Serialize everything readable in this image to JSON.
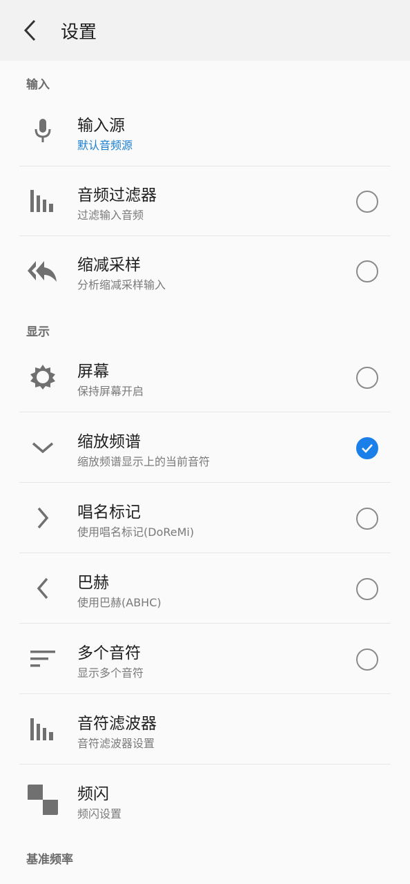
{
  "header": {
    "title": "设置",
    "back_icon": "back-arrow-icon"
  },
  "sections": {
    "input": {
      "header": "输入",
      "items": [
        {
          "title": "输入源",
          "subtitle": "默认音频源",
          "icon": "microphone-icon"
        },
        {
          "title": "音频过滤器",
          "subtitle": "过滤输入音频",
          "icon": "bars-icon",
          "checked": false
        },
        {
          "title": "缩减采样",
          "subtitle": "分析缩减采样输入",
          "icon": "double-reply-icon",
          "checked": false
        }
      ]
    },
    "display": {
      "header": "显示",
      "items": [
        {
          "title": "屏幕",
          "subtitle": "保持屏幕开启",
          "icon": "brightness-icon",
          "checked": false
        },
        {
          "title": "缩放频谱",
          "subtitle": "缩放频谱显示上的当前音符",
          "icon": "chevron-down-icon",
          "checked": true
        },
        {
          "title": "唱名标记",
          "subtitle": "使用唱名标记(DoReMi)",
          "icon": "chevron-right-icon",
          "checked": false
        },
        {
          "title": "巴赫",
          "subtitle": "使用巴赫(ABHC)",
          "icon": "chevron-left-icon",
          "checked": false
        },
        {
          "title": "多个音符",
          "subtitle": "显示多个音符",
          "icon": "sort-lines-icon",
          "checked": false
        },
        {
          "title": "音符滤波器",
          "subtitle": "音符滤波器设置",
          "icon": "bars-icon"
        },
        {
          "title": "频闪",
          "subtitle": "频闪设置",
          "icon": "checker-icon"
        }
      ]
    },
    "reference": {
      "header": "基准频率"
    }
  },
  "colors": {
    "accent": "#1a7fe8",
    "link": "#1a7fd4",
    "icon": "#707070"
  }
}
